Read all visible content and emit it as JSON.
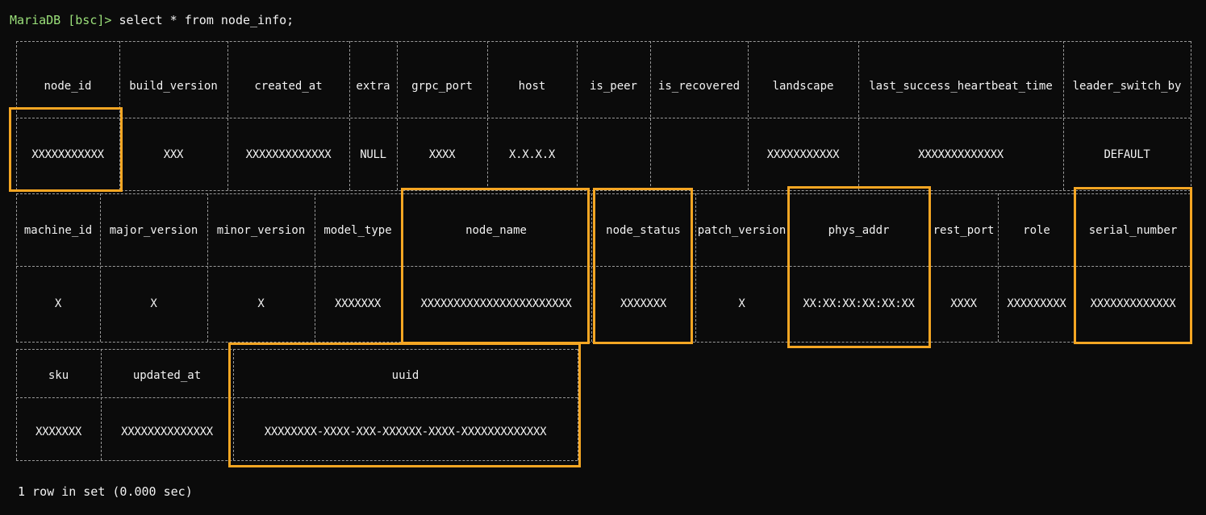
{
  "terminal": {
    "prompt": "MariaDB [bsc]>",
    "command": " select * from node_info;",
    "status": "1 row in set (0.000 sec)"
  },
  "table1": {
    "headers": [
      "node_id",
      "build_version",
      "created_at",
      "extra",
      "grpc_port",
      "host",
      "is_peer",
      "is_recovered",
      "landscape",
      "last_success_heartbeat_time",
      "leader_switch_by"
    ],
    "values": [
      "XXXXXXXXXXX",
      "XXX",
      "XXXXXXXXXXXXX",
      "NULL",
      "XXXX",
      "X.X.X.X",
      "",
      "",
      "XXXXXXXXXXX",
      "XXXXXXXXXXXXX",
      "DEFAULT"
    ]
  },
  "table2": {
    "headers": [
      "machine_id",
      "major_version",
      "minor_version",
      "model_type",
      "node_name",
      "node_status",
      "patch_version",
      "phys_addr",
      "rest_port",
      "role",
      "serial_number"
    ],
    "values": [
      "X",
      "X",
      "X",
      "XXXXXXX",
      "XXXXXXXXXXXXXXXXXXXXXXX",
      "XXXXXXX",
      "X",
      "XX:XX:XX:XX:XX:XX",
      "XXXX",
      "XXXXXXXXX",
      "XXXXXXXXXXXXX"
    ]
  },
  "table3": {
    "headers": [
      "sku",
      "updated_at",
      "uuid"
    ],
    "values": [
      "XXXXXXX",
      "XXXXXXXXXXXXXX",
      "XXXXXXXX-XXXX-XXX-XXXXXX-XXXX-XXXXXXXXXXXXX"
    ]
  },
  "highlight_color": "#f5a623",
  "prompt_color": "#9be07a"
}
